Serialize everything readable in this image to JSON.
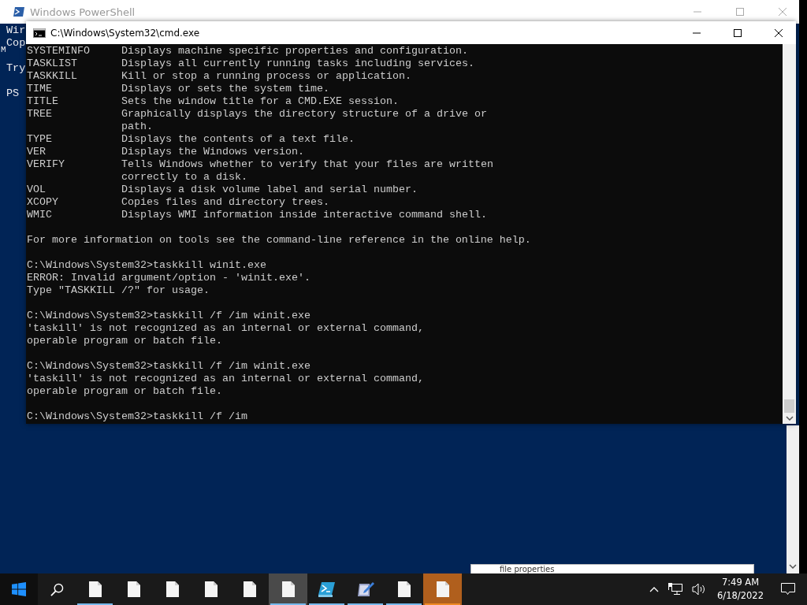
{
  "powershell_window": {
    "title": "Windows PowerShell",
    "active": false,
    "edge_text": "M",
    "blocks": [
      [
        "Wir",
        "Cop"
      ],
      [
        "Try"
      ],
      [
        "PS"
      ]
    ]
  },
  "cmd_window": {
    "title": "C:\\Windows\\System32\\cmd.exe",
    "active": true,
    "help_rows": [
      {
        "command": "SYSTEMINFO",
        "description": "Displays machine specific properties and configuration."
      },
      {
        "command": "TASKLIST",
        "description": "Displays all currently running tasks including services."
      },
      {
        "command": "TASKKILL",
        "description": "Kill or stop a running process or application."
      },
      {
        "command": "TIME",
        "description": "Displays or sets the system time."
      },
      {
        "command": "TITLE",
        "description": "Sets the window title for a CMD.EXE session."
      },
      {
        "command": "TREE",
        "description": "Graphically displays the directory structure of a drive or"
      },
      {
        "description": "path."
      },
      {
        "command": "TYPE",
        "description": "Displays the contents of a text file."
      },
      {
        "command": "VER",
        "description": "Displays the Windows version."
      },
      {
        "command": "VERIFY",
        "description": "Tells Windows whether to verify that your files are written"
      },
      {
        "description": "correctly to a disk."
      },
      {
        "command": "VOL",
        "description": "Displays a disk volume label and serial number."
      },
      {
        "command": "XCOPY",
        "description": "Copies files and directory trees."
      },
      {
        "command": "WMIC",
        "description": "Displays WMI information inside interactive command shell."
      }
    ],
    "output_blocks": [
      [
        "For more information on tools see the command-line reference in the online help."
      ],
      [
        "C:\\Windows\\System32>taskkill winit.exe",
        "ERROR: Invalid argument/option - 'winit.exe'.",
        "Type \"TASKKILL /?\" for usage."
      ],
      [
        "C:\\Windows\\System32>taskkill /f /im winit.exe",
        "'taskill' is not recognized as an internal or external command,",
        "operable program or batch file."
      ],
      [
        "C:\\Windows\\System32>taskkill /f /im winit.exe",
        "'taskill' is not recognized as an internal or external command,",
        "operable program or batch file."
      ],
      [
        "C:\\Windows\\System32>taskkill /f /im"
      ]
    ]
  },
  "background_popup": {
    "text": "file properties"
  },
  "taskbar": {
    "items": [
      {
        "kind": "file",
        "running": true,
        "selected": false,
        "attention": false
      },
      {
        "kind": "file",
        "running": false,
        "selected": false,
        "attention": false
      },
      {
        "kind": "file",
        "running": false,
        "selected": false,
        "attention": false
      },
      {
        "kind": "file",
        "running": false,
        "selected": false,
        "attention": false
      },
      {
        "kind": "file",
        "running": false,
        "selected": false,
        "attention": false
      },
      {
        "kind": "file",
        "running": true,
        "selected": true,
        "attention": false
      },
      {
        "kind": "powershell",
        "running": true,
        "selected": false,
        "attention": false
      },
      {
        "kind": "editor",
        "running": true,
        "selected": false,
        "attention": false
      },
      {
        "kind": "file",
        "running": true,
        "selected": false,
        "attention": false
      },
      {
        "kind": "file",
        "running": true,
        "selected": false,
        "attention": true
      }
    ],
    "time": "7:49 AM",
    "date": "6/18/2022"
  }
}
